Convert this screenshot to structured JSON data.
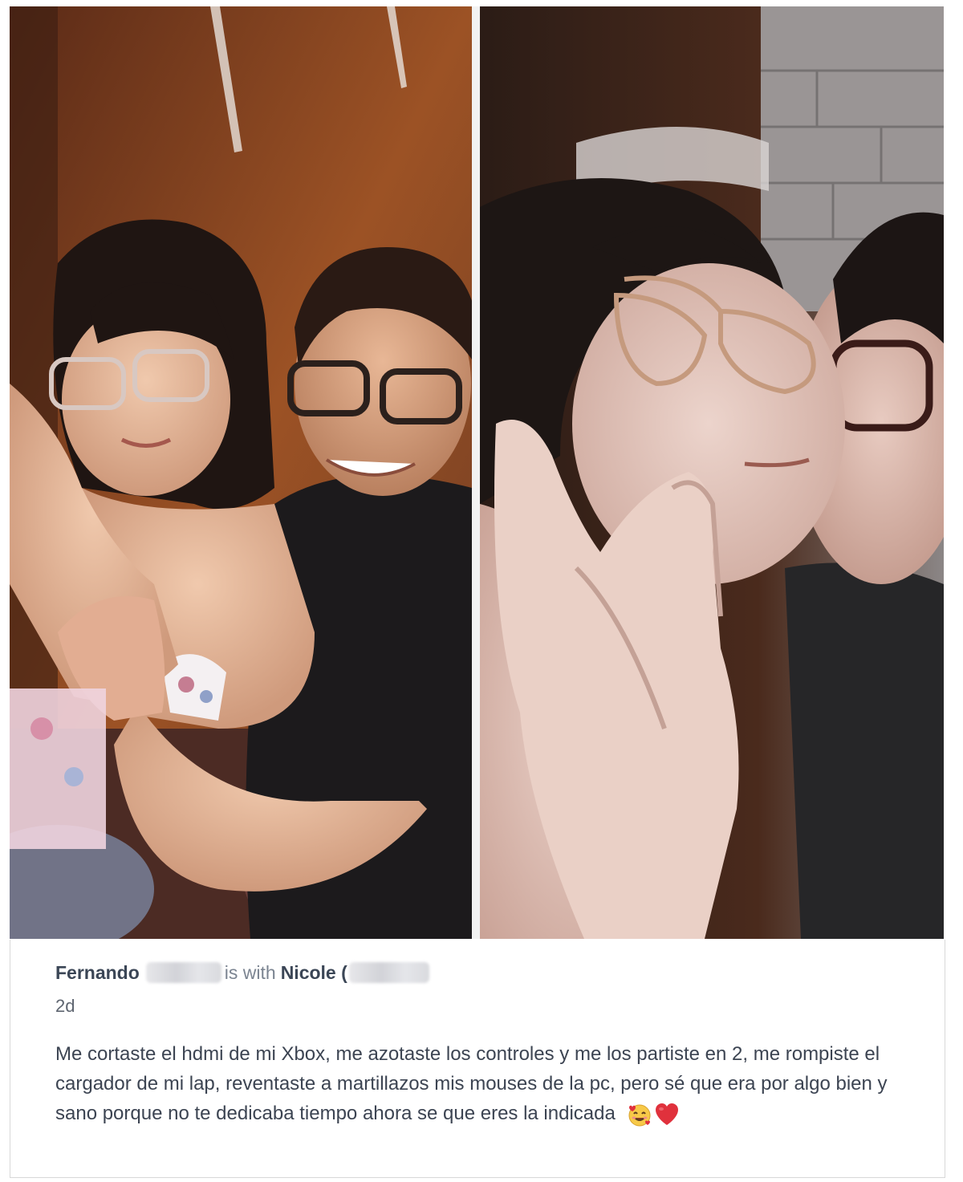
{
  "post": {
    "author": "Fernando",
    "with_text": "is with",
    "tagged_user": "Nicole (",
    "timestamp": "2d",
    "body": "Me cortaste el hdmi de mi Xbox, me azotaste los controles y me los partiste en 2, me rompiste el cargador de mi lap, reventaste a martillazos mis mouses de la pc, pero sé que era por algo bien y sano porque no te dedicaba tiempo ahora se que eres la indicada",
    "emojis": [
      "smiling-face-with-hearts-icon",
      "red-heart-icon"
    ]
  },
  "colors": {
    "author": "#3b4656",
    "body_text": "#3c4452",
    "secondary_text": "#7b8491",
    "heart": "#e0313c"
  }
}
